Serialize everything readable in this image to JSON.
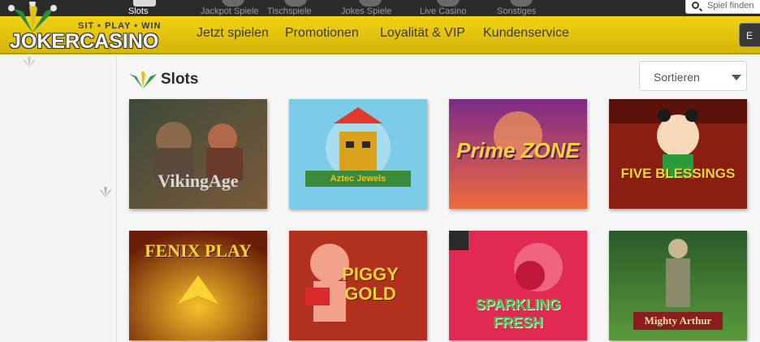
{
  "top_categories": [
    {
      "label": "Slots",
      "icon": "slots-icon",
      "active": true
    },
    {
      "label": "Jackpot Spiele",
      "icon": "jackpot-icon",
      "active": false
    },
    {
      "label": "Tischspiele",
      "icon": "table-games-icon",
      "active": false
    },
    {
      "label": "Jokes Spiele",
      "icon": "joker-games-icon",
      "active": false
    },
    {
      "label": "Live Casino",
      "icon": "live-casino-icon",
      "active": false
    },
    {
      "label": "Sonstiges",
      "icon": "misc-icon",
      "active": false
    }
  ],
  "search": {
    "placeholder": "Spiel finden"
  },
  "logo": {
    "tagline": "SIT • PLAY • WIN",
    "name": "JOKERCASINO"
  },
  "nav": {
    "links": [
      "Jetzt spielen",
      "Promotionen",
      "Loyalität & VIP",
      "Kundenservice"
    ],
    "right_button_label": "E"
  },
  "main": {
    "section_title": "Slots",
    "sort_label": "Sortieren"
  },
  "games": [
    {
      "title": "VikingAge",
      "colors": [
        "#3d4a3a",
        "#7a5a3a"
      ],
      "text_color": "#d8d8d8"
    },
    {
      "title": "Aztec Jewels",
      "colors": [
        "#6fc4e4",
        "#a8dcef"
      ],
      "text_color": "#f2c21a"
    },
    {
      "title": "Prime ZONE",
      "colors": [
        "#7b2a8a",
        "#f06a3a"
      ],
      "text_color": "#f7d431"
    },
    {
      "title": "FIVE BLESSINGS",
      "colors": [
        "#8a1e12",
        "#c0391e"
      ],
      "text_color": "#f7d431"
    },
    {
      "title": "FENIX PLAY",
      "colors": [
        "#6a1e08",
        "#e89a1a"
      ],
      "text_color": "#f7d431"
    },
    {
      "title": "PIGGY GOLD",
      "colors": [
        "#a8281c",
        "#e04a2a"
      ],
      "text_color": "#f7d431"
    },
    {
      "title": "SPARKLING FRESH",
      "colors": [
        "#d8214a",
        "#f05a78"
      ],
      "text_color": "#3cc24a"
    },
    {
      "title": "Mighty Arthur",
      "colors": [
        "#1e4a1e",
        "#5a9a3a"
      ],
      "text_color": "#f2e2a2"
    }
  ],
  "colors": {
    "brand_yellow": "#f1d214",
    "topbar": "#2b2b2b",
    "text_dark": "#3d3a20"
  }
}
